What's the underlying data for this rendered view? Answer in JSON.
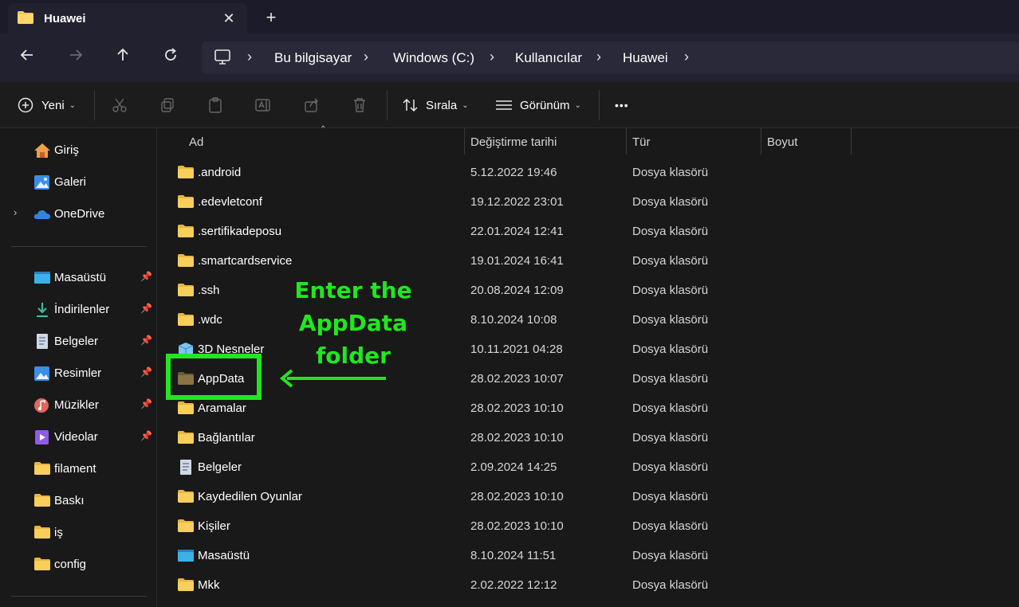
{
  "window": {
    "tab_title": "Huawei",
    "tab_close": "✕",
    "new_tab": "+"
  },
  "navigation": {
    "breadcrumbs": [
      "Bu bilgisayar",
      "Windows (C:)",
      "Kullanıcılar",
      "Huawei"
    ]
  },
  "toolbar": {
    "new_label": "Yeni",
    "sort_label": "Sırala",
    "view_label": "Görünüm",
    "more_label": "•••"
  },
  "sidebar": {
    "top_items": [
      {
        "label": "Giriş",
        "icon": "home-icon"
      },
      {
        "label": "Galeri",
        "icon": "gallery-icon"
      },
      {
        "label": "OneDrive",
        "icon": "onedrive-icon"
      }
    ],
    "pinned_items": [
      {
        "label": "Masaüstü",
        "icon": "desktop-icon"
      },
      {
        "label": "İndirilenler",
        "icon": "downloads-icon"
      },
      {
        "label": "Belgeler",
        "icon": "documents-icon"
      },
      {
        "label": "Resimler",
        "icon": "pictures-icon"
      },
      {
        "label": "Müzikler",
        "icon": "music-icon"
      },
      {
        "label": "Videolar",
        "icon": "videos-icon"
      }
    ],
    "folder_items": [
      {
        "label": "filament"
      },
      {
        "label": "Baskı"
      },
      {
        "label": "iş"
      },
      {
        "label": "config"
      }
    ]
  },
  "file_list": {
    "columns": [
      "Ad",
      "Değiştirme tarihi",
      "Tür",
      "Boyut"
    ],
    "rows": [
      {
        "name": ".android",
        "date": "5.12.2022 19:46",
        "type": "Dosya klasörü",
        "icon": "folder-icon"
      },
      {
        "name": ".edevletconf",
        "date": "19.12.2022 23:01",
        "type": "Dosya klasörü",
        "icon": "folder-icon"
      },
      {
        "name": ".sertifikadeposu",
        "date": "22.01.2024 12:41",
        "type": "Dosya klasörü",
        "icon": "folder-icon"
      },
      {
        "name": ".smartcardservice",
        "date": "19.01.2024 16:41",
        "type": "Dosya klasörü",
        "icon": "folder-icon"
      },
      {
        "name": ".ssh",
        "date": "20.08.2024 12:09",
        "type": "Dosya klasörü",
        "icon": "folder-icon"
      },
      {
        "name": ".wdc",
        "date": "8.10.2024 10:08",
        "type": "Dosya klasörü",
        "icon": "folder-icon"
      },
      {
        "name": "3D Nesneler",
        "date": "10.11.2021 04:28",
        "type": "Dosya klasörü",
        "icon": "3d-objects-icon"
      },
      {
        "name": "AppData",
        "date": "28.02.2023 10:07",
        "type": "Dosya klasörü",
        "icon": "hidden-folder-icon"
      },
      {
        "name": "Aramalar",
        "date": "28.02.2023 10:10",
        "type": "Dosya klasörü",
        "icon": "folder-icon"
      },
      {
        "name": "Bağlantılar",
        "date": "28.02.2023 10:10",
        "type": "Dosya klasörü",
        "icon": "folder-icon"
      },
      {
        "name": "Belgeler",
        "date": "2.09.2024 14:25",
        "type": "Dosya klasörü",
        "icon": "documents-icon"
      },
      {
        "name": "Kaydedilen Oyunlar",
        "date": "28.02.2023 10:10",
        "type": "Dosya klasörü",
        "icon": "folder-icon"
      },
      {
        "name": "Kişiler",
        "date": "28.02.2023 10:10",
        "type": "Dosya klasörü",
        "icon": "folder-icon"
      },
      {
        "name": "Masaüstü",
        "date": "8.10.2024 11:51",
        "type": "Dosya klasörü",
        "icon": "desktop-icon"
      },
      {
        "name": "Mkk",
        "date": "2.02.2022 12:12",
        "type": "Dosya klasörü",
        "icon": "folder-icon"
      }
    ]
  },
  "annotation": {
    "lines": [
      "Enter the",
      "AppData",
      "folder"
    ],
    "color": "#22e61f"
  },
  "colors": {
    "folder": "#f6c94a",
    "titlebar": "#1c1b2a",
    "navbar": "#222130",
    "background": "#191919"
  }
}
